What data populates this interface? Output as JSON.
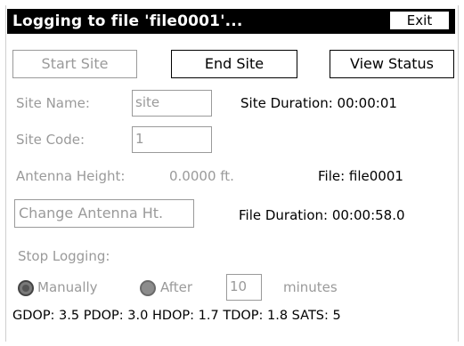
{
  "title": "Logging to file 'file0001'...",
  "exit_label": "Exit",
  "buttons": {
    "start_site": "Start Site",
    "end_site": "End Site",
    "view_status": "View Status",
    "change_antenna": "Change Antenna Ht."
  },
  "site_name": {
    "label": "Site Name:",
    "value": "site"
  },
  "site_code": {
    "label": "Site Code:",
    "value": "1"
  },
  "site_duration": "Site Duration: 00:00:01",
  "antenna": {
    "label": "Antenna Height:",
    "value": "0.0000 ft."
  },
  "file": "File: file0001",
  "file_duration": "File Duration:  00:00:58.0",
  "stop_logging": {
    "label": "Stop Logging:",
    "manually": "Manually",
    "after": "After",
    "minutes_value": "10",
    "minutes_label": "minutes",
    "selected": "Manually"
  },
  "status_line": "GDOP: 3.5 PDOP: 3.0 HDOP: 1.7 TDOP: 1.8 SATS: 5",
  "colors": {
    "titlebar": "#000000",
    "disabled": "#9a9a9a"
  }
}
